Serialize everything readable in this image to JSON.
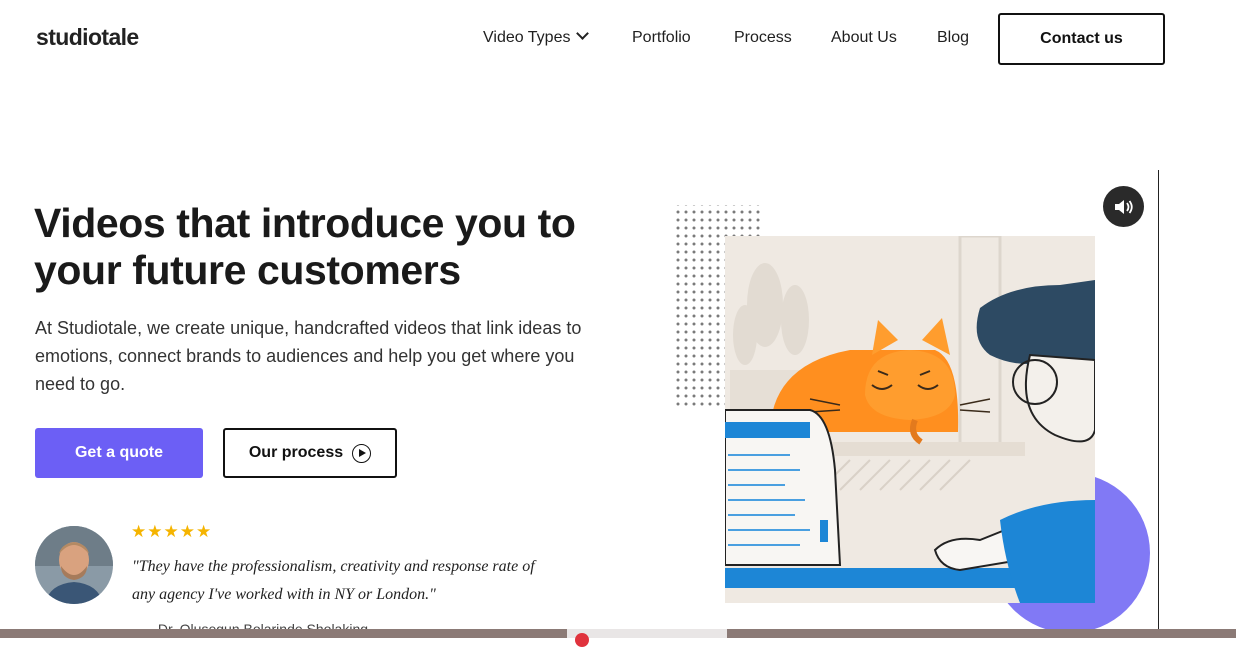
{
  "header": {
    "logo": "studiotale",
    "nav": [
      {
        "label": "Video Types",
        "has_dropdown": true,
        "icon": "chevron-down-icon"
      },
      {
        "label": "Portfolio"
      },
      {
        "label": "Process"
      },
      {
        "label": "About Us"
      },
      {
        "label": "Blog"
      }
    ],
    "contact_label": "Contact us"
  },
  "hero": {
    "title": "Videos that introduce you to your future customers",
    "text": "At Studiotale, we create unique, handcrafted videos that link ideas to emotions, connect brands to audiences and help you get where you need to go.",
    "quote_button": "Get a quote",
    "process_button": "Our process",
    "process_icon": "play-circle-icon"
  },
  "testimonial": {
    "rating": 5,
    "stars": "★★★★★",
    "quote": "\"They have the professionalism, creativity and response rate of any agency I've worked with in NY or London.\"",
    "author": "— Dr. Olusegun Bolarinde Sholaking..."
  },
  "media": {
    "sound_icon": "speaker-icon",
    "illustration": "cat-on-desk-illustration"
  },
  "colors": {
    "accent": "#6c5ff5",
    "star": "#f5b400",
    "cat": "#ff8f1f",
    "screen_blue": "#1d86d6"
  }
}
